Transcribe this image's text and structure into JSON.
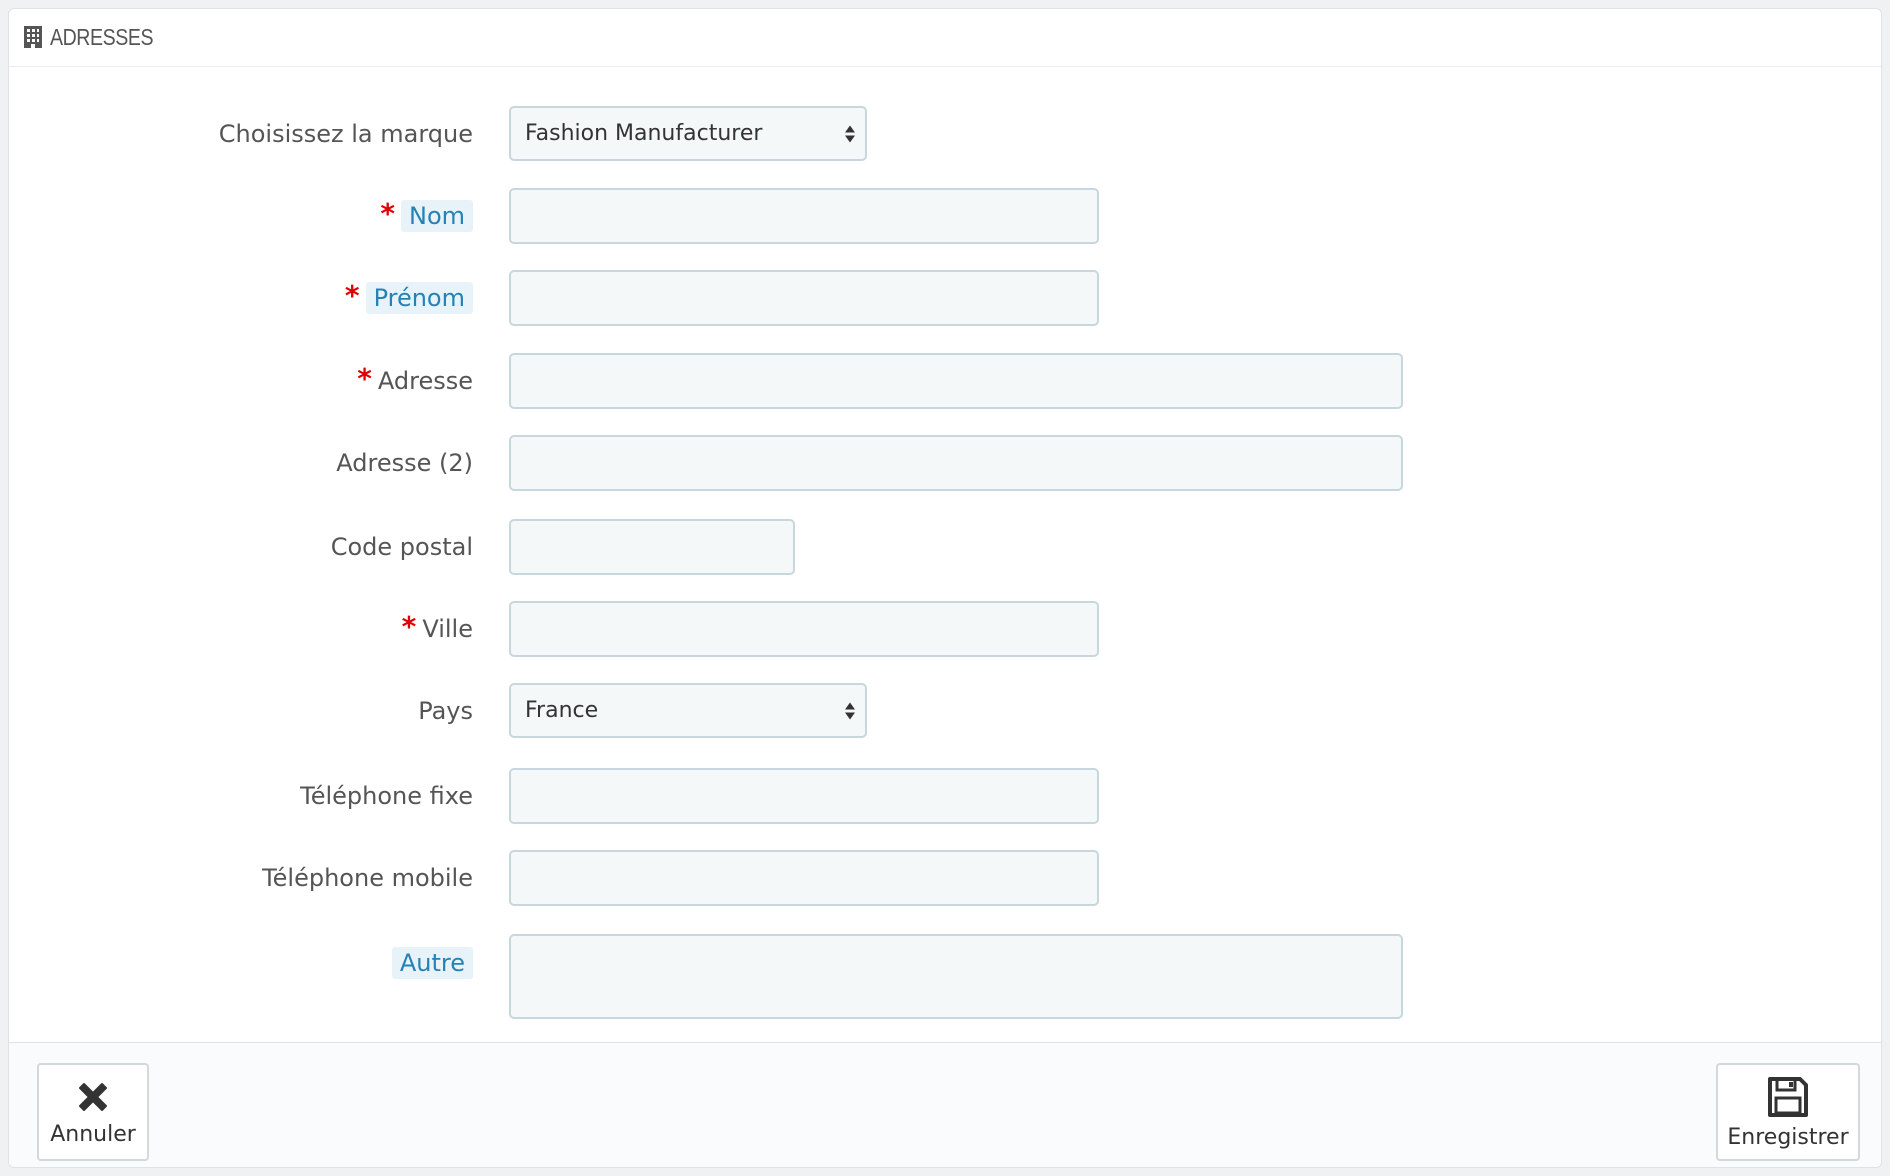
{
  "panel": {
    "title": "ADRESSES"
  },
  "form": {
    "brand": {
      "label": "Choisissez la marque",
      "value": "Fashion Manufacturer"
    },
    "lastname": {
      "required": "*",
      "label": "Nom",
      "value": ""
    },
    "firstname": {
      "required": "*",
      "label": "Prénom",
      "value": ""
    },
    "address": {
      "required": "*",
      "label": "Adresse",
      "value": ""
    },
    "address2": {
      "label": "Adresse (2)",
      "value": ""
    },
    "postcode": {
      "label": "Code postal",
      "value": ""
    },
    "city": {
      "required": "*",
      "label": "Ville",
      "value": ""
    },
    "country": {
      "label": "Pays",
      "value": "France"
    },
    "phone": {
      "label": "Téléphone fixe",
      "value": ""
    },
    "mobile": {
      "label": "Téléphone mobile",
      "value": ""
    },
    "other": {
      "label": "Autre",
      "value": ""
    }
  },
  "footer": {
    "cancel_label": "Annuler",
    "save_label": "Enregistrer"
  },
  "colors": {
    "required": "#e00000",
    "hint_text": "#2581b6",
    "hint_bg": "#e7f3f9",
    "field_bg": "#f5f8f9",
    "field_border": "#c8d7dd"
  },
  "icons": {
    "header": "building-icon",
    "cancel": "close-icon",
    "save": "floppy-disk-icon"
  }
}
